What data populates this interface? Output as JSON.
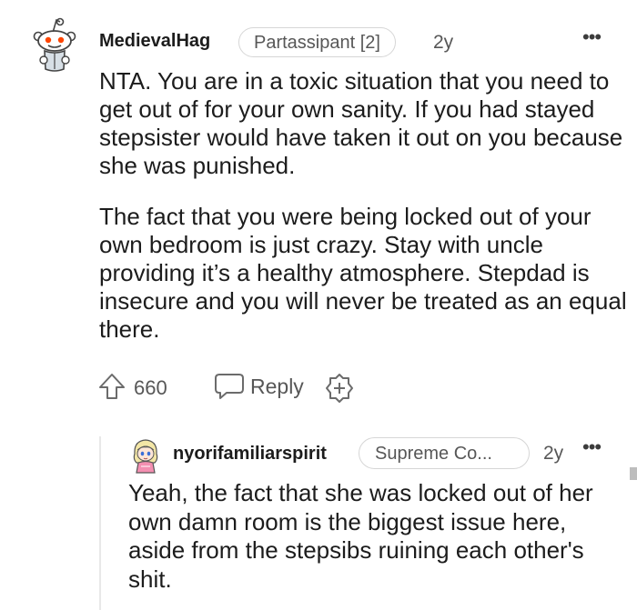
{
  "comment": {
    "author": "MedievalHag",
    "flair": "Partassipant [2]",
    "age": "2y",
    "more_label": "•••",
    "paragraphs": [
      "NTA. You are in a toxic situation that you need to get out of for your own sanity. If you had stayed stepsister would have taken it out on you because she was punished.",
      "The fact that you were being locked out of your own bedroom is just crazy. Stay with uncle providing it’s a healthy atmosphere. Stepdad is insecure and you will never be treated as an equal there."
    ],
    "score": "660",
    "reply_label": "Reply",
    "icons": {
      "avatar": "snoo-avatar-icon",
      "upvote": "upvote-arrow-icon",
      "reply": "speech-bubble-icon",
      "award": "award-plus-icon",
      "more": "more-options-icon"
    }
  },
  "reply": {
    "author": "nyorifamiliarspirit",
    "flair": "Supreme Co...",
    "age": "2y",
    "more_label": "•••",
    "text": "Yeah, the fact that she was locked out of her own damn room is the biggest issue here, aside from the stepsibs ruining each other's shit.",
    "icons": {
      "avatar": "anime-girl-avatar-icon",
      "more": "more-options-icon"
    }
  },
  "colors": {
    "text": "#1c1c1c",
    "muted": "#575757",
    "border": "#d6d6d6"
  }
}
